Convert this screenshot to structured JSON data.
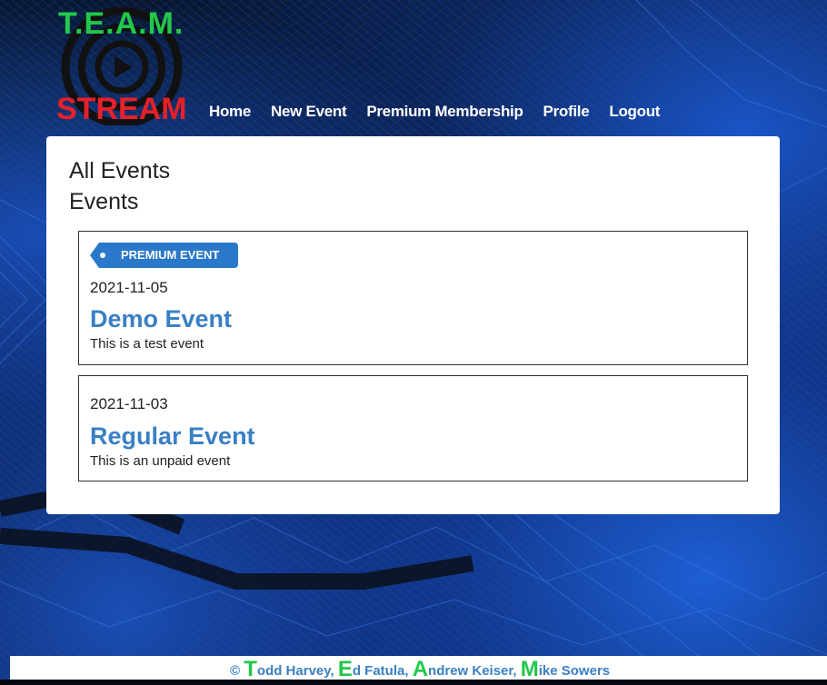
{
  "header": {
    "logo_top": "T.E.A.M.",
    "logo_bottom": "STREAM",
    "nav": [
      {
        "label": "Home"
      },
      {
        "label": "New Event"
      },
      {
        "label": "Premium Membership"
      },
      {
        "label": "Profile"
      },
      {
        "label": "Logout"
      }
    ]
  },
  "main": {
    "page_title": "All Events",
    "section_title": "Events",
    "events": [
      {
        "badge": "PREMIUM EVENT",
        "date": "2021-11-05",
        "name": "Demo Event",
        "description": "This is a test event"
      },
      {
        "badge": "",
        "date": "2021-11-03",
        "name": "Regular Event",
        "description": "This is an unpaid event"
      }
    ]
  },
  "footer": {
    "copyright": "©",
    "authors": [
      {
        "initial": "T",
        "rest": "odd Harvey,"
      },
      {
        "initial": "E",
        "rest": "d Fatula,"
      },
      {
        "initial": "A",
        "rest": "ndrew Keiser,"
      },
      {
        "initial": "M",
        "rest": "ike Sowers"
      }
    ]
  },
  "colors": {
    "link_blue": "#3a80c4",
    "badge_blue": "#2a78c9",
    "logo_green": "#22c84a",
    "logo_red": "#e8202a"
  },
  "icons": {
    "logo": "play-broadcast-icon"
  }
}
